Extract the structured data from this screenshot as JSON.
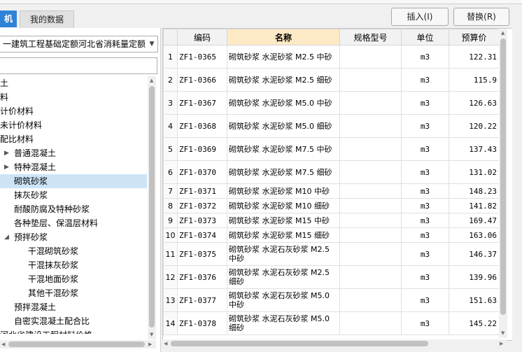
{
  "tabs": [
    {
      "label": "机"
    },
    {
      "label": "我的数据"
    }
  ],
  "toolbar": {
    "insert_label": "插入(I)",
    "replace_label": "替换(R)"
  },
  "left": {
    "quota_select": "一建筑工程基础定额河北省消耗量定额",
    "search_value": "",
    "tree": [
      {
        "label": "土",
        "indent": 0,
        "toggle": ""
      },
      {
        "label": "料",
        "indent": 0,
        "toggle": ""
      },
      {
        "label": "计价材料",
        "indent": 0,
        "toggle": ""
      },
      {
        "label": "未计价材料",
        "indent": 0,
        "toggle": ""
      },
      {
        "label": "配比材料",
        "indent": 0,
        "toggle": ""
      },
      {
        "label": "普通混凝土",
        "indent": 20,
        "toggle": "▶"
      },
      {
        "label": "特种混凝土",
        "indent": 20,
        "toggle": "▶"
      },
      {
        "label": "砌筑砂浆",
        "indent": 20,
        "toggle": "",
        "selected": true
      },
      {
        "label": "抹灰砂浆",
        "indent": 20,
        "toggle": ""
      },
      {
        "label": "耐酸防腐及特种砂浆",
        "indent": 20,
        "toggle": ""
      },
      {
        "label": "各种垫层、保温层材料",
        "indent": 20,
        "toggle": ""
      },
      {
        "label": "预拌砂浆",
        "indent": 20,
        "toggle": "◢"
      },
      {
        "label": "干混砌筑砂浆",
        "indent": 40,
        "toggle": ""
      },
      {
        "label": "干混抹灰砂浆",
        "indent": 40,
        "toggle": ""
      },
      {
        "label": "干混地面砂浆",
        "indent": 40,
        "toggle": ""
      },
      {
        "label": "其他干混砂浆",
        "indent": 40,
        "toggle": ""
      },
      {
        "label": "预拌混凝土",
        "indent": 20,
        "toggle": ""
      },
      {
        "label": "自密实混凝土配合比",
        "indent": 20,
        "toggle": ""
      },
      {
        "label": "河北省建设工程材料价格",
        "indent": 0,
        "toggle": ""
      }
    ]
  },
  "grid": {
    "columns": [
      "",
      "编码",
      "名称",
      "规格型号",
      "单位",
      "预算价"
    ],
    "rows": [
      {
        "n": "1",
        "code": "ZF1-0365",
        "name": "砌筑砂浆 水泥砂浆 M2.5 中砂",
        "spec": "",
        "unit": "m3",
        "price": "122.31"
      },
      {
        "n": "2",
        "code": "ZF1-0366",
        "name": "砌筑砂浆 水泥砂浆 M2.5 细砂",
        "spec": "",
        "unit": "m3",
        "price": "115.9"
      },
      {
        "n": "3",
        "code": "ZF1-0367",
        "name": "砌筑砂浆 水泥砂浆 M5.0 中砂",
        "spec": "",
        "unit": "m3",
        "price": "126.63"
      },
      {
        "n": "4",
        "code": "ZF1-0368",
        "name": "砌筑砂浆 水泥砂浆 M5.0 细砂",
        "spec": "",
        "unit": "m3",
        "price": "120.22"
      },
      {
        "n": "5",
        "code": "ZF1-0369",
        "name": "砌筑砂浆 水泥砂浆 M7.5 中砂",
        "spec": "",
        "unit": "m3",
        "price": "137.43"
      },
      {
        "n": "6",
        "code": "ZF1-0370",
        "name": "砌筑砂浆 水泥砂浆 M7.5 细砂",
        "spec": "",
        "unit": "m3",
        "price": "131.02"
      },
      {
        "n": "7",
        "code": "ZF1-0371",
        "name": "砌筑砂浆 水泥砂浆 M10 中砂",
        "spec": "",
        "unit": "m3",
        "price": "148.23"
      },
      {
        "n": "8",
        "code": "ZF1-0372",
        "name": "砌筑砂浆 水泥砂浆 M10 细砂",
        "spec": "",
        "unit": "m3",
        "price": "141.82"
      },
      {
        "n": "9",
        "code": "ZF1-0373",
        "name": "砌筑砂浆 水泥砂浆 M15 中砂",
        "spec": "",
        "unit": "m3",
        "price": "169.47"
      },
      {
        "n": "10",
        "code": "ZF1-0374",
        "name": "砌筑砂浆 水泥砂浆 M15 细砂",
        "spec": "",
        "unit": "m3",
        "price": "163.06"
      },
      {
        "n": "11",
        "code": "ZF1-0375",
        "name": "砌筑砂浆 水泥石灰砂浆 M2.5 中砂",
        "spec": "",
        "unit": "m3",
        "price": "146.37"
      },
      {
        "n": "12",
        "code": "ZF1-0376",
        "name": "砌筑砂浆 水泥石灰砂浆 M2.5 细砂",
        "spec": "",
        "unit": "m3",
        "price": "139.96"
      },
      {
        "n": "13",
        "code": "ZF1-0377",
        "name": "砌筑砂浆 水泥石灰砂浆 M5.0 中砂",
        "spec": "",
        "unit": "m3",
        "price": "151.63"
      },
      {
        "n": "14",
        "code": "ZF1-0378",
        "name": "砌筑砂浆 水泥石灰砂浆 M5.0 细砂",
        "spec": "",
        "unit": "m3",
        "price": "145.22"
      }
    ]
  },
  "colors": {
    "accent_tab": "#2f83d6",
    "selected_tree": "#cde4f7",
    "name_header": "#fde9c5"
  }
}
